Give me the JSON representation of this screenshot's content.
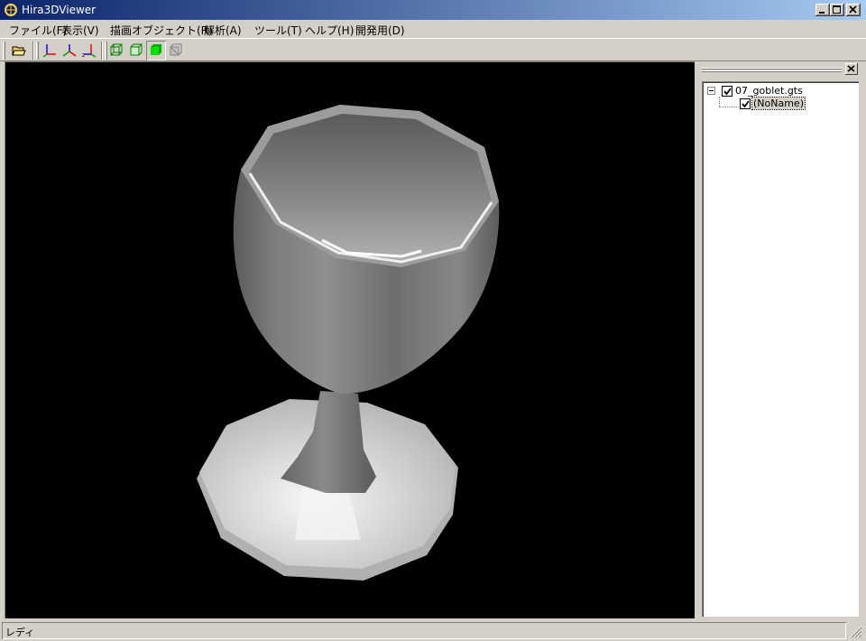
{
  "window": {
    "title": "Hira3DViewer"
  },
  "menu": [
    {
      "label": "ファイル(F)"
    },
    {
      "label": "表示(V)"
    },
    {
      "label": "描画オブジェクト(R)"
    },
    {
      "label": "解析(A)"
    },
    {
      "label": "ツール(T)"
    },
    {
      "label": "ヘルプ(H)"
    },
    {
      "label": "開発用(D)"
    }
  ],
  "toolbar": {
    "buttons": [
      "open-folder-icon",
      "axis-xy-icon",
      "axis-xyz-icon",
      "axis-zy-icon",
      "wireframe-icon",
      "hidden-line-icon",
      "solid-shaded-icon",
      "disabled-view-icon"
    ]
  },
  "tree": {
    "root": {
      "label": "07_goblet.gts",
      "checked": true,
      "expanded": true
    },
    "child": {
      "label": "(NoName)",
      "checked": true,
      "selected": true
    }
  },
  "status": {
    "text": "レディ"
  },
  "colors": {
    "titlebar_start": "#0a246a",
    "titlebar_end": "#a6caf0",
    "viewport_bg": "#000000",
    "face": "#d4d0c8"
  }
}
